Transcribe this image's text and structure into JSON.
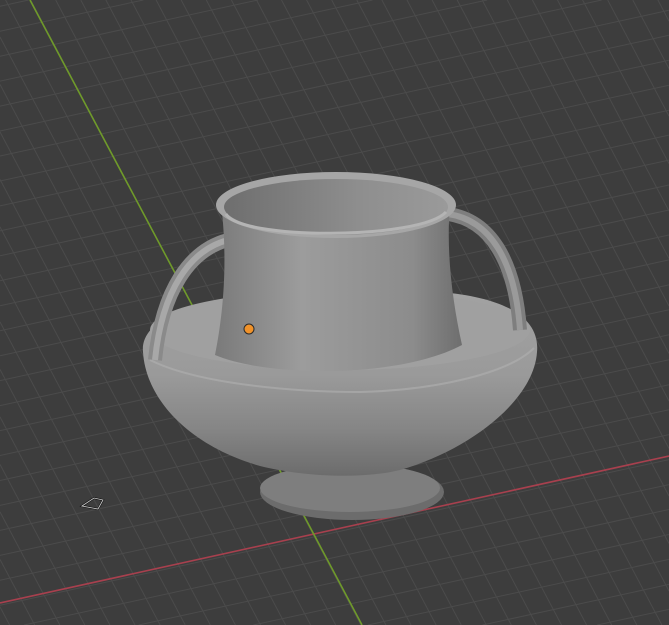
{
  "viewport": {
    "background_color": "#3d3d3d",
    "grid_color": "#4b4b4b",
    "x_axis_color": "#a8404e",
    "y_axis_color": "#6f9a2a",
    "object_color": "#9a9a9a",
    "origin_color": "#f0922a",
    "light_icon": "light-object-icon"
  }
}
